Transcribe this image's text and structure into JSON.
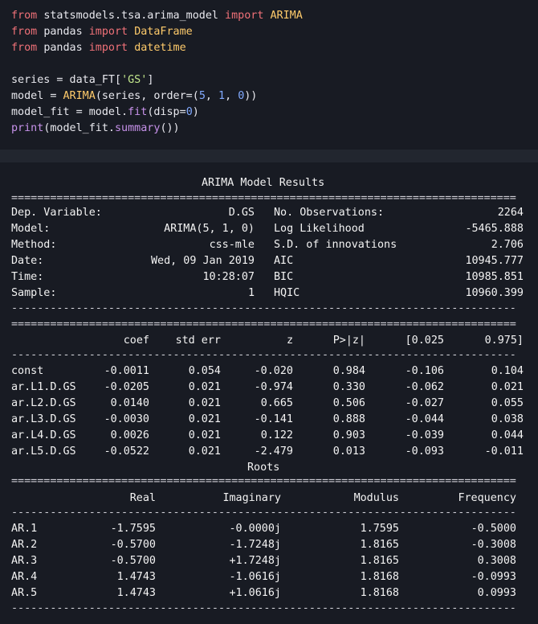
{
  "code": {
    "line1": {
      "kw_from": "from",
      "module": "statsmodels.tsa.arima_model",
      "kw_import": "import",
      "name": "ARIMA"
    },
    "line2": {
      "kw_from": "from",
      "module": "pandas",
      "kw_import": "import",
      "name": "DataFrame"
    },
    "line3": {
      "kw_from": "from",
      "module": "pandas",
      "kw_import": "import",
      "name": "datetime"
    },
    "line4": {
      "lhs": "series = data_FT[",
      "str": "'GS'",
      "rhs": "]"
    },
    "line5": {
      "lhs": "model = ",
      "fn": "ARIMA",
      "mid": "(series, order=(",
      "n1": "5",
      "c1": ", ",
      "n2": "1",
      "c2": ", ",
      "n3": "0",
      "rhs": "))"
    },
    "line6": {
      "lhs": "model_fit = model.",
      "fn": "fit",
      "mid": "(disp=",
      "n1": "0",
      "rhs": ")"
    },
    "line7": {
      "fn": "print",
      "mid": "(model_fit.",
      "fn2": "summary",
      "rhs": "())"
    }
  },
  "output": {
    "title": "ARIMA Model Results",
    "sep_eq": "==============================================================================",
    "sep_dash": "------------------------------------------------------------------------------",
    "info_left": [
      {
        "label": "Dep. Variable:",
        "value": "D.GS"
      },
      {
        "label": "Model:",
        "value": "ARIMA(5, 1, 0)"
      },
      {
        "label": "Method:",
        "value": "css-mle"
      },
      {
        "label": "Date:",
        "value": "Wed, 09 Jan 2019"
      },
      {
        "label": "Time:",
        "value": "10:28:07"
      },
      {
        "label": "Sample:",
        "value": "1"
      }
    ],
    "info_right": [
      {
        "label": "No. Observations:",
        "value": "2264"
      },
      {
        "label": "Log Likelihood",
        "value": "-5465.888"
      },
      {
        "label": "S.D. of innovations",
        "value": "2.706"
      },
      {
        "label": "AIC",
        "value": "10945.777"
      },
      {
        "label": "BIC",
        "value": "10985.851"
      },
      {
        "label": "HQIC",
        "value": "10960.399"
      }
    ],
    "coef_headers": [
      "coef",
      "std err",
      "z",
      "P>|z|",
      "[0.025",
      "0.975]"
    ],
    "coef_rows": [
      {
        "name": "const",
        "vals": [
          "-0.0011",
          "0.054",
          "-0.020",
          "0.984",
          "-0.106",
          "0.104"
        ]
      },
      {
        "name": "ar.L1.D.GS",
        "vals": [
          "-0.0205",
          "0.021",
          "-0.974",
          "0.330",
          "-0.062",
          "0.021"
        ]
      },
      {
        "name": "ar.L2.D.GS",
        "vals": [
          "0.0140",
          "0.021",
          "0.665",
          "0.506",
          "-0.027",
          "0.055"
        ]
      },
      {
        "name": "ar.L3.D.GS",
        "vals": [
          "-0.0030",
          "0.021",
          "-0.141",
          "0.888",
          "-0.044",
          "0.038"
        ]
      },
      {
        "name": "ar.L4.D.GS",
        "vals": [
          "0.0026",
          "0.021",
          "0.122",
          "0.903",
          "-0.039",
          "0.044"
        ]
      },
      {
        "name": "ar.L5.D.GS",
        "vals": [
          "-0.0522",
          "0.021",
          "-2.479",
          "0.013",
          "-0.093",
          "-0.011"
        ]
      }
    ],
    "roots_title": "Roots",
    "roots_headers": [
      "Real",
      "Imaginary",
      "Modulus",
      "Frequency"
    ],
    "roots_rows": [
      {
        "name": "AR.1",
        "vals": [
          "-1.7595",
          "-0.0000j",
          "1.7595",
          "-0.5000"
        ]
      },
      {
        "name": "AR.2",
        "vals": [
          "-0.5700",
          "-1.7248j",
          "1.8165",
          "-0.3008"
        ]
      },
      {
        "name": "AR.3",
        "vals": [
          "-0.5700",
          "+1.7248j",
          "1.8165",
          "0.3008"
        ]
      },
      {
        "name": "AR.4",
        "vals": [
          "1.4743",
          "-1.0616j",
          "1.8168",
          "-0.0993"
        ]
      },
      {
        "name": "AR.5",
        "vals": [
          "1.4743",
          "+1.0616j",
          "1.8168",
          "0.0993"
        ]
      }
    ]
  }
}
